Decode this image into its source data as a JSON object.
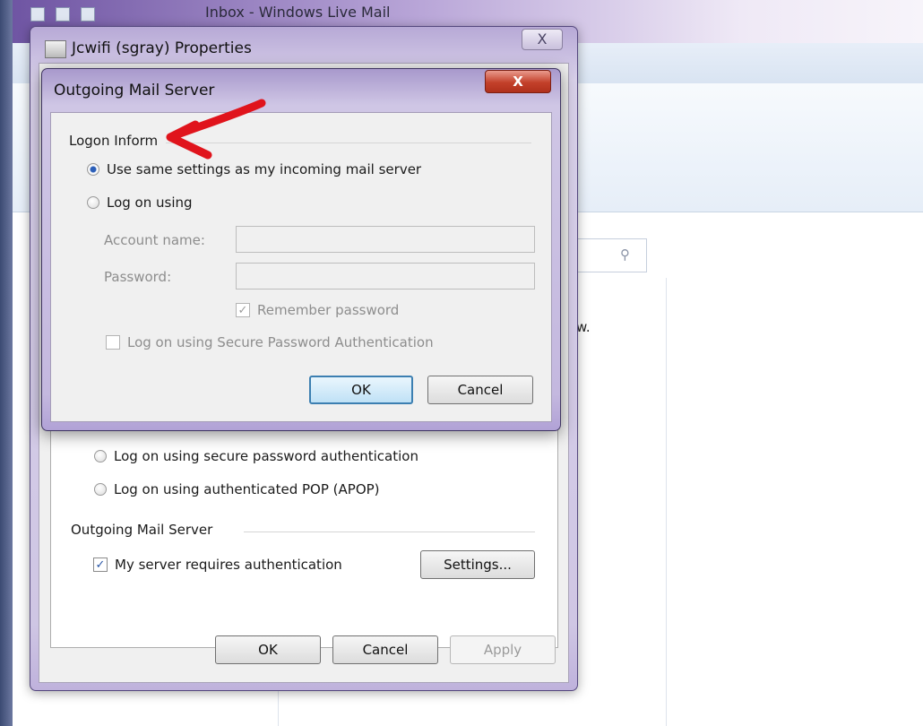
{
  "background_window": {
    "title": "Inbox - Windows Live Mail",
    "truncated_text": "w."
  },
  "properties_dialog": {
    "title": "Jcwifi (sgray) Properties",
    "close_label": "X",
    "incoming_options": [
      {
        "label": "Log on using secure password authentication",
        "selected": false
      },
      {
        "label": "Log on using authenticated POP (APOP)",
        "selected": false
      }
    ],
    "outgoing_section_title": "Outgoing Mail Server",
    "requires_auth_label": "My server requires authentication",
    "requires_auth_checked": true,
    "settings_button": "Settings...",
    "buttons": {
      "ok": "OK",
      "cancel": "Cancel",
      "apply": "Apply"
    }
  },
  "outgoing_dialog": {
    "title": "Outgoing Mail Server",
    "close_label": "X",
    "section_title": "Logon Inform",
    "option_same": "Use same settings as my incoming mail server",
    "option_same_selected": true,
    "option_logon": "Log on using",
    "account_label": "Account name:",
    "account_value": "",
    "password_label": "Password:",
    "password_value": "",
    "remember_label": "Remember password",
    "remember_checked": true,
    "spa_label": "Log on using Secure Password Authentication",
    "spa_checked": false,
    "ok": "OK",
    "cancel": "Cancel"
  },
  "annotation": {
    "arrow_color": "#e0141c"
  },
  "colors": {
    "accent": "#2c5fb8",
    "close_red": "#c3402a",
    "default_button_border": "#3c7fb1"
  }
}
